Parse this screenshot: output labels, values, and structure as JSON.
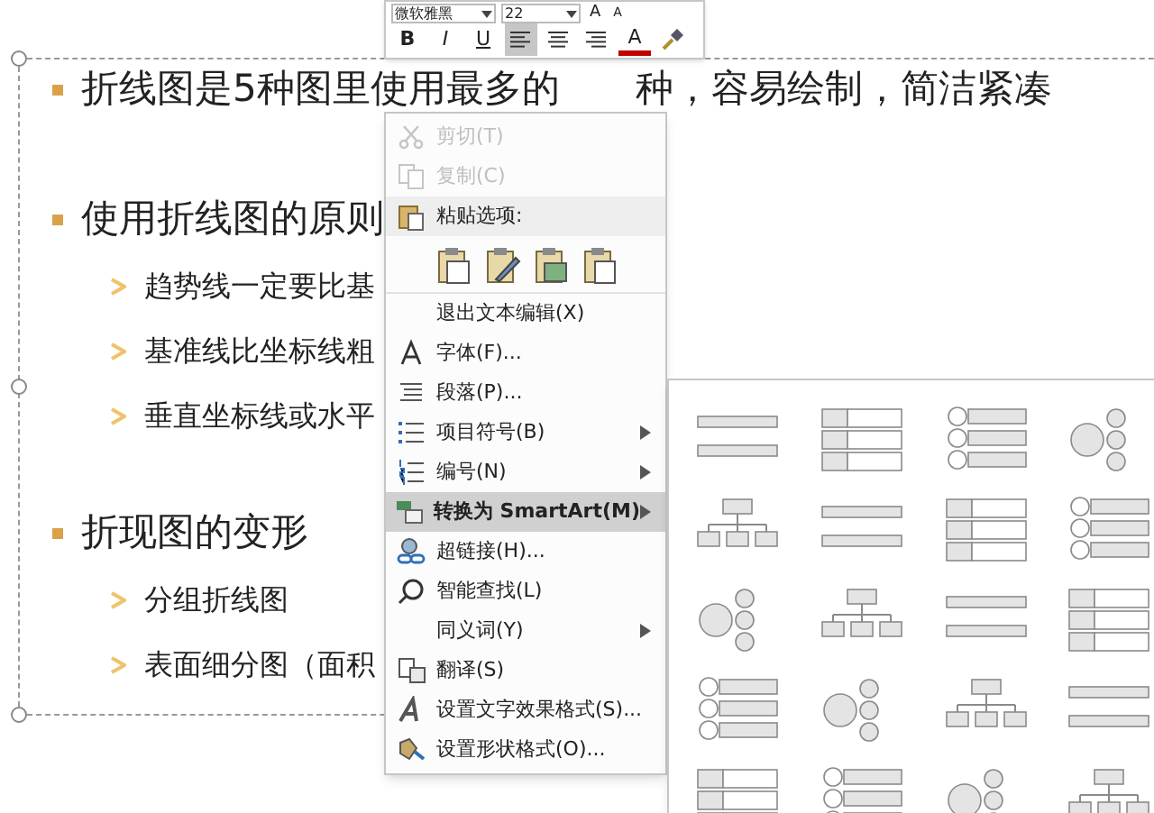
{
  "slide": {
    "sections": [
      {
        "title_parts": [
          "折线图是5种图里使用最多的",
          "种，容易绘制，简洁紧凑"
        ]
      },
      {
        "title_parts": [
          "使用折线图的原则"
        ],
        "items": [
          "趋势线一定要比基",
          "基准线比坐标线粗",
          "垂直坐标线或水平"
        ]
      },
      {
        "title_parts": [
          "折现图的变形"
        ],
        "items": [
          "分组折线图",
          "表面细分图（面积"
        ]
      }
    ]
  },
  "toolbar": {
    "font": "微软雅黑",
    "size": "22",
    "grow_label": "A",
    "shrink_label": "A",
    "buttons": [
      {
        "kind": "bold",
        "label": "B",
        "selected": false
      },
      {
        "kind": "italic",
        "label": "I",
        "selected": false
      },
      {
        "kind": "underline",
        "label": "U",
        "selected": false
      },
      {
        "kind": "align_left",
        "selected": true
      },
      {
        "kind": "align_center",
        "selected": false
      },
      {
        "kind": "align_right",
        "selected": false
      },
      {
        "kind": "font_color",
        "label": "A",
        "selected": false
      },
      {
        "kind": "format_painter",
        "selected": false
      }
    ]
  },
  "context_menu": [
    {
      "kind": "cut",
      "label": "剪切(T)",
      "disabled": true,
      "selected": false,
      "submenu": false
    },
    {
      "kind": "copy",
      "label": "复制(C)",
      "disabled": true,
      "selected": false,
      "submenu": false
    },
    {
      "kind": "paste_header",
      "label": "粘贴选项:",
      "disabled": false,
      "selected": false,
      "submenu": false
    },
    {
      "kind": "paste_row"
    },
    {
      "kind": "plain",
      "label": "退出文本编辑(X)",
      "disabled": false,
      "selected": false,
      "submenu": false
    },
    {
      "kind": "font",
      "label": "字体(F)...",
      "disabled": false,
      "selected": false,
      "submenu": false
    },
    {
      "kind": "paragraph",
      "label": "段落(P)...",
      "disabled": false,
      "selected": false,
      "submenu": false
    },
    {
      "kind": "bullets",
      "label": "项目符号(B)",
      "disabled": false,
      "selected": false,
      "submenu": true
    },
    {
      "kind": "numbering",
      "label": "编号(N)",
      "disabled": false,
      "selected": false,
      "submenu": true
    },
    {
      "kind": "smartart",
      "label": "转换为 SmartArt(M)",
      "disabled": false,
      "selected": true,
      "submenu": true
    },
    {
      "kind": "link",
      "label": "超链接(H)...",
      "disabled": false,
      "selected": false,
      "submenu": false
    },
    {
      "kind": "lookup",
      "label": "智能查找(L)",
      "disabled": false,
      "selected": false,
      "submenu": false
    },
    {
      "kind": "plain",
      "label": "同义词(Y)",
      "disabled": false,
      "selected": false,
      "submenu": true
    },
    {
      "kind": "translate",
      "label": "翻译(S)",
      "disabled": false,
      "selected": false,
      "submenu": false
    },
    {
      "kind": "text_effect",
      "label": "设置文字效果格式(S)...",
      "disabled": false,
      "selected": false,
      "submenu": false
    },
    {
      "kind": "shape_format",
      "label": "设置形状格式(O)...",
      "disabled": false,
      "selected": false,
      "submenu": false
    }
  ]
}
